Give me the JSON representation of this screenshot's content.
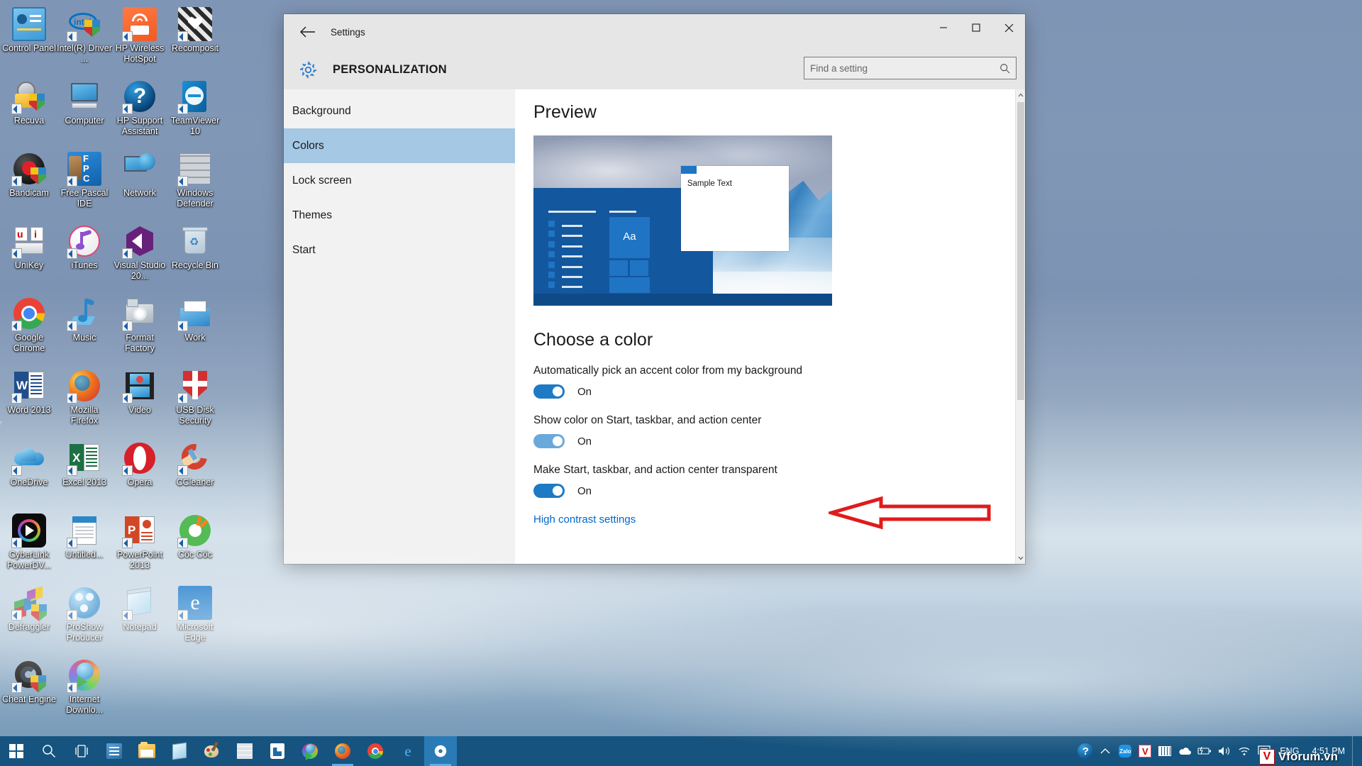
{
  "desktop": {
    "icons": [
      {
        "label": "Control Panel",
        "icon": "control-panel-icon",
        "shortcut": false
      },
      {
        "label": "Intel(R) Driver ...",
        "icon": "intel-driver-icon",
        "shortcut": true
      },
      {
        "label": "HP Wireless HotSpot",
        "icon": "hp-wireless-hotspot-icon",
        "shortcut": true
      },
      {
        "label": "Recomposit",
        "icon": "recomposit-icon",
        "shortcut": true
      },
      {
        "label": "Recuva",
        "icon": "recuva-icon",
        "shortcut": true
      },
      {
        "label": "Computer",
        "icon": "computer-icon",
        "shortcut": false
      },
      {
        "label": "HP Support Assistant",
        "icon": "hp-support-assistant-icon",
        "shortcut": true
      },
      {
        "label": "TeamViewer 10",
        "icon": "teamviewer-icon",
        "shortcut": true
      },
      {
        "label": "Bandicam",
        "icon": "bandicam-icon",
        "shortcut": true
      },
      {
        "label": "Free Pascal IDE",
        "icon": "free-pascal-icon",
        "shortcut": true
      },
      {
        "label": "Network",
        "icon": "network-icon",
        "shortcut": false
      },
      {
        "label": "Windows Defender",
        "icon": "windows-defender-icon",
        "shortcut": true
      },
      {
        "label": "UniKey",
        "icon": "unikey-icon",
        "shortcut": true
      },
      {
        "label": "iTunes",
        "icon": "itunes-icon",
        "shortcut": true
      },
      {
        "label": "Visual Studio 20...",
        "icon": "visual-studio-icon",
        "shortcut": true
      },
      {
        "label": "Recycle Bin",
        "icon": "recycle-bin-icon",
        "shortcut": false
      },
      {
        "label": "Google Chrome",
        "icon": "google-chrome-icon",
        "shortcut": true
      },
      {
        "label": "Music",
        "icon": "music-icon",
        "shortcut": true
      },
      {
        "label": "Format Factory",
        "icon": "format-factory-icon",
        "shortcut": true
      },
      {
        "label": "Work",
        "icon": "work-folder-icon",
        "shortcut": true
      },
      {
        "label": "Word 2013",
        "icon": "word-icon",
        "shortcut": true
      },
      {
        "label": "Mozilla Firefox",
        "icon": "firefox-icon",
        "shortcut": true
      },
      {
        "label": "Video",
        "icon": "video-icon",
        "shortcut": true
      },
      {
        "label": "USB Disk Security",
        "icon": "usb-disk-security-icon",
        "shortcut": true
      },
      {
        "label": "OneDrive",
        "icon": "onedrive-icon",
        "shortcut": true
      },
      {
        "label": "Excel 2013",
        "icon": "excel-icon",
        "shortcut": true
      },
      {
        "label": "Opera",
        "icon": "opera-icon",
        "shortcut": true
      },
      {
        "label": "CCleaner",
        "icon": "ccleaner-icon",
        "shortcut": true
      },
      {
        "label": "CyberLink PowerDV...",
        "icon": "cyberlink-powerdvd-icon",
        "shortcut": true
      },
      {
        "label": "Untitled...",
        "icon": "untitled-document-icon",
        "shortcut": true
      },
      {
        "label": "PowerPoint 2013",
        "icon": "powerpoint-icon",
        "shortcut": true
      },
      {
        "label": "Cốc Cốc",
        "icon": "coccoc-icon",
        "shortcut": true
      },
      {
        "label": "Defraggler",
        "icon": "defraggler-icon",
        "shortcut": true
      },
      {
        "label": "ProShow Producer",
        "icon": "proshow-producer-icon",
        "shortcut": true
      },
      {
        "label": "Notepad",
        "icon": "notepad-icon",
        "shortcut": true
      },
      {
        "label": "Microsoft Edge",
        "icon": "microsoft-edge-icon",
        "shortcut": true
      },
      {
        "label": "Cheat Engine",
        "icon": "cheat-engine-icon",
        "shortcut": true
      },
      {
        "label": "Internet Downlo...",
        "icon": "internet-download-manager-icon",
        "shortcut": true
      }
    ]
  },
  "window": {
    "title": "Settings",
    "back_icon": "back-arrow-icon",
    "minimize_label": "Minimize",
    "maximize_label": "Maximize",
    "close_label": "Close",
    "page_title": "PERSONALIZATION",
    "page_icon": "gear-icon",
    "search": {
      "placeholder": "Find a setting",
      "value": "",
      "icon": "search-icon"
    }
  },
  "sidebar": {
    "items": [
      {
        "label": "Background",
        "selected": false
      },
      {
        "label": "Colors",
        "selected": true
      },
      {
        "label": "Lock screen",
        "selected": false
      },
      {
        "label": "Themes",
        "selected": false
      },
      {
        "label": "Start",
        "selected": false
      }
    ]
  },
  "main": {
    "preview_heading": "Preview",
    "preview": {
      "sample_text": "Sample Text",
      "tile_text": "Aa"
    },
    "choose_color_heading": "Choose a color",
    "options": [
      {
        "label": "Automatically pick an accent color from my background",
        "state": "On",
        "toggle_on": true,
        "dim": false
      },
      {
        "label": "Show color on Start, taskbar, and action center",
        "state": "On",
        "toggle_on": true,
        "dim": true
      },
      {
        "label": "Make Start, taskbar, and action center transparent",
        "state": "On",
        "toggle_on": true,
        "dim": false
      }
    ],
    "high_contrast_link": "High contrast settings"
  },
  "annotation": {
    "type": "red-left-arrow",
    "color": "#e01b1b"
  },
  "taskbar": {
    "buttons": [
      {
        "name": "start-button",
        "icon": "windows-logo-icon",
        "active": false,
        "running": false
      },
      {
        "name": "search-button",
        "icon": "search-icon",
        "active": false,
        "running": false
      },
      {
        "name": "task-view-button",
        "icon": "task-view-icon",
        "active": false,
        "running": false
      },
      {
        "name": "app-sticky-notes",
        "icon": "sticky-notes-icon",
        "active": false,
        "running": false
      },
      {
        "name": "app-file-explorer",
        "icon": "file-explorer-icon",
        "active": false,
        "running": false
      },
      {
        "name": "app-notepad",
        "icon": "notepad-icon",
        "active": false,
        "running": false
      },
      {
        "name": "app-paint",
        "icon": "paint-icon",
        "active": false,
        "running": false
      },
      {
        "name": "app-windows-defender",
        "icon": "windows-defender-icon",
        "active": false,
        "running": false
      },
      {
        "name": "app-store",
        "icon": "store-icon",
        "active": false,
        "running": false
      },
      {
        "name": "app-internet-download-manager",
        "icon": "internet-download-manager-icon",
        "active": false,
        "running": false
      },
      {
        "name": "app-firefox",
        "icon": "firefox-icon",
        "active": false,
        "running": true
      },
      {
        "name": "app-chrome",
        "icon": "google-chrome-icon",
        "active": false,
        "running": false
      },
      {
        "name": "app-edge",
        "icon": "microsoft-edge-icon",
        "active": false,
        "running": false
      },
      {
        "name": "app-settings",
        "icon": "gear-icon",
        "active": true,
        "running": true
      }
    ],
    "tray": {
      "icons": [
        {
          "name": "help-icon",
          "label": "Get help"
        },
        {
          "name": "show-hidden-icons-icon",
          "label": "Show hidden icons"
        },
        {
          "name": "zalo-icon",
          "label": "Zalo"
        },
        {
          "name": "vcard-icon",
          "label": "V"
        },
        {
          "name": "keyboard-icon",
          "label": "Keyboard"
        },
        {
          "name": "onedrive-icon",
          "label": "OneDrive"
        },
        {
          "name": "battery-icon",
          "label": "Battery"
        },
        {
          "name": "volume-icon",
          "label": "Volume"
        },
        {
          "name": "wifi-icon",
          "label": "Network"
        },
        {
          "name": "action-center-icon",
          "label": "Action center"
        }
      ],
      "language": "ENG",
      "time": "4:51 PM",
      "date": ""
    }
  },
  "watermark": {
    "text": "Vforum.vn",
    "badge": "V"
  },
  "colors": {
    "accent": "#1e7ac4",
    "selection": "#a5c8e4",
    "taskbar": "#16547f",
    "annotation_red": "#e01b1b",
    "link_blue": "#0066cc"
  }
}
